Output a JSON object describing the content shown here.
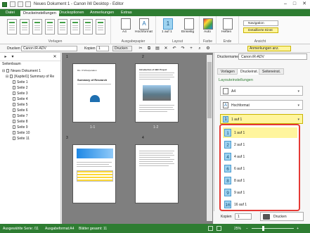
{
  "window": {
    "title": "Neues Dokument 1 - Canon iW Desktop - Editor"
  },
  "ribbon_tabs": [
    "Datei",
    "Druckeinstellungen",
    "Druckoptionen",
    "Anmerkungen",
    "Extras"
  ],
  "ribbon": {
    "vorlagen_label": "Vorlagen",
    "ausgabepapier_label": "Ausgabepapier",
    "paper_size": "A4",
    "orientation": "Hochformat",
    "layout_label": "Layout",
    "layout_value": "1 auf 1",
    "single_sided": "Einseitig",
    "farbe_label": "Farbe",
    "color_value": "Auto",
    "ende_label": "Ende",
    "staple": "Heften",
    "ansicht_label": "Ansicht",
    "navigation": "Navigation",
    "details": "Detaillierte Einst"
  },
  "toolbar": {
    "drucken_label": "Drucken",
    "printer": "Canon iR-ADV",
    "kopien_label": "Kopien",
    "copies": "1",
    "print_button": "Drucken",
    "annotations_button": "Anmerkungen anz."
  },
  "left_panel": {
    "title": "Seitenbaum",
    "root": "Neues Dokument 1",
    "chapter": "[Kapitel1] Summary of Re",
    "pages": [
      "Seite 1",
      "Seite 2",
      "Seite 3",
      "Seite 4",
      "Seite 5",
      "Seite 6",
      "Seite 7",
      "Seite 8",
      "Seite 9",
      "Seite 10",
      "Seite 11"
    ]
  },
  "center": {
    "page_numbers": [
      "1",
      "2",
      "3",
      "4"
    ],
    "page_labels": [
      "1-1",
      "1-2"
    ],
    "p1_company": "Rix. XYZCorporation",
    "p1_title": "Summary of Research",
    "p2_title": "Introduction of ABC Project"
  },
  "right_panel": {
    "printer_label": "Druckername:",
    "printer": "Canon iR-ADV",
    "tabs": [
      "Vorlagen",
      "Druckeinst.",
      "Seiteneinst."
    ],
    "section": "Layouteinstellungen",
    "paper": "A4",
    "orientation": "Hochformat",
    "layout": "1 auf 1",
    "options": [
      {
        "num": "1",
        "label": "1 auf 1"
      },
      {
        "num": "2",
        "label": "2 auf 1"
      },
      {
        "num": "4",
        "label": "4 auf 1"
      },
      {
        "num": "6",
        "label": "6 auf 1"
      },
      {
        "num": "8",
        "label": "8 auf 1"
      },
      {
        "num": "9",
        "label": "9 auf 1"
      },
      {
        "num": "16",
        "label": "16 auf 1"
      }
    ],
    "kopien_label": "Kopien",
    "copies": "1",
    "print_button": "Drucken"
  },
  "statusbar": {
    "series": "Ausgewählte Serie: /11",
    "format": "Ausgabeformat:A4",
    "sheets": "Blätter gesamt: 11",
    "zoom": "25%"
  },
  "colors": {
    "brand": "#2e7d32",
    "highlight": "#fff59d",
    "callout": "#e53935"
  }
}
